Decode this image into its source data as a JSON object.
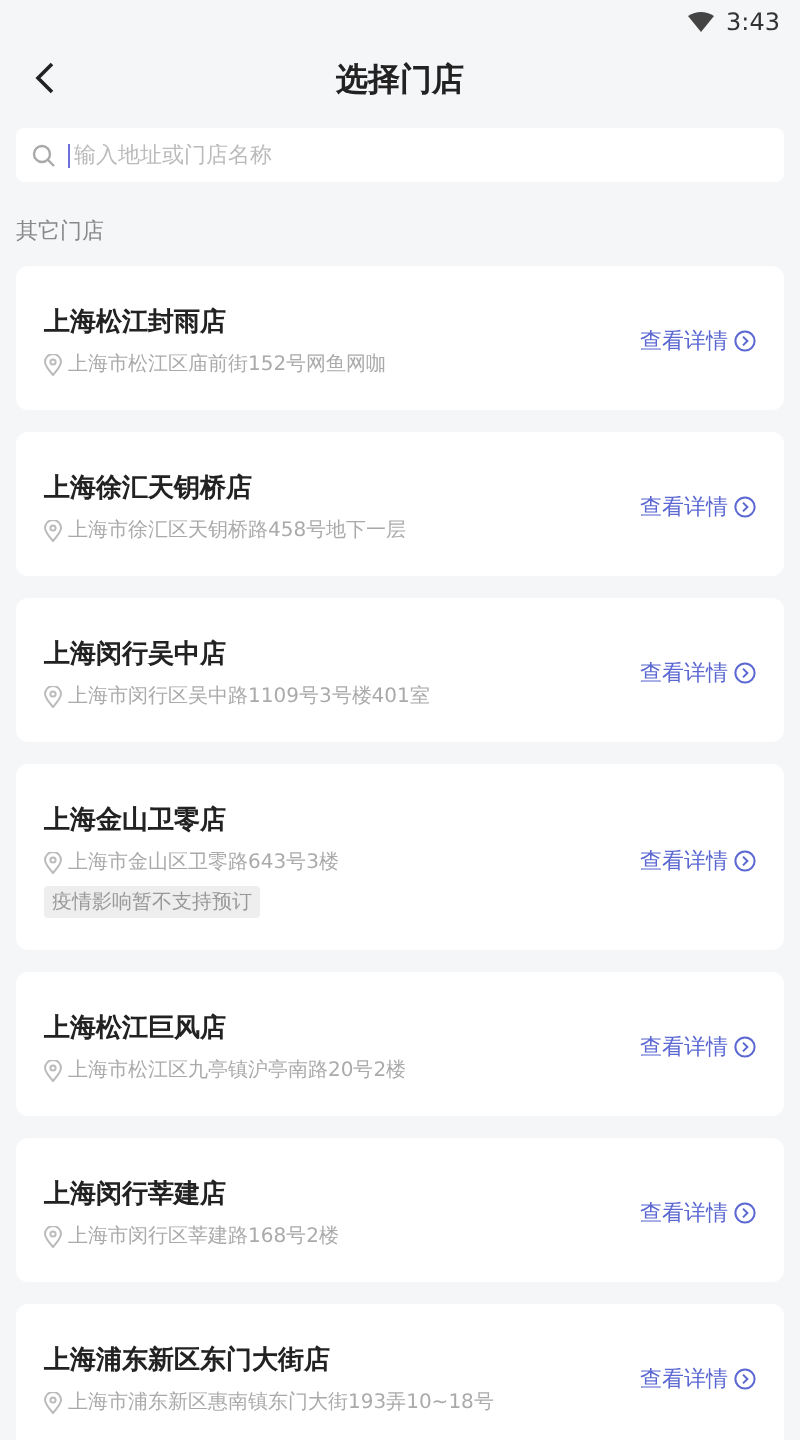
{
  "status_bar": {
    "time": "3:43"
  },
  "header": {
    "title": "选择门店"
  },
  "search": {
    "placeholder": "输入地址或门店名称"
  },
  "section_label": "其它门店",
  "stores": [
    {
      "name": "上海松江封雨店",
      "address": "上海市松江区庙前街152号网鱼网咖",
      "link": "查看详情"
    },
    {
      "name": "上海徐汇天钥桥店",
      "address": "上海市徐汇区天钥桥路458号地下一层",
      "link": "查看详情"
    },
    {
      "name": "上海闵行吴中店",
      "address": "上海市闵行区吴中路1109号3号楼401室",
      "link": "查看详情"
    },
    {
      "name": "上海金山卫零店",
      "address": "上海市金山区卫零路643号3楼",
      "notice": "疫情影响暂不支持预订",
      "link": "查看详情"
    },
    {
      "name": "上海松江巨风店",
      "address": "上海市松江区九亭镇沪亭南路20号2楼",
      "link": "查看详情"
    },
    {
      "name": "上海闵行莘建店",
      "address": "上海市闵行区莘建路168号2楼",
      "link": "查看详情"
    },
    {
      "name": "上海浦东新区东门大街店",
      "address": "上海市浦东新区惠南镇东门大街193弄10~18号",
      "link": "查看详情"
    }
  ]
}
